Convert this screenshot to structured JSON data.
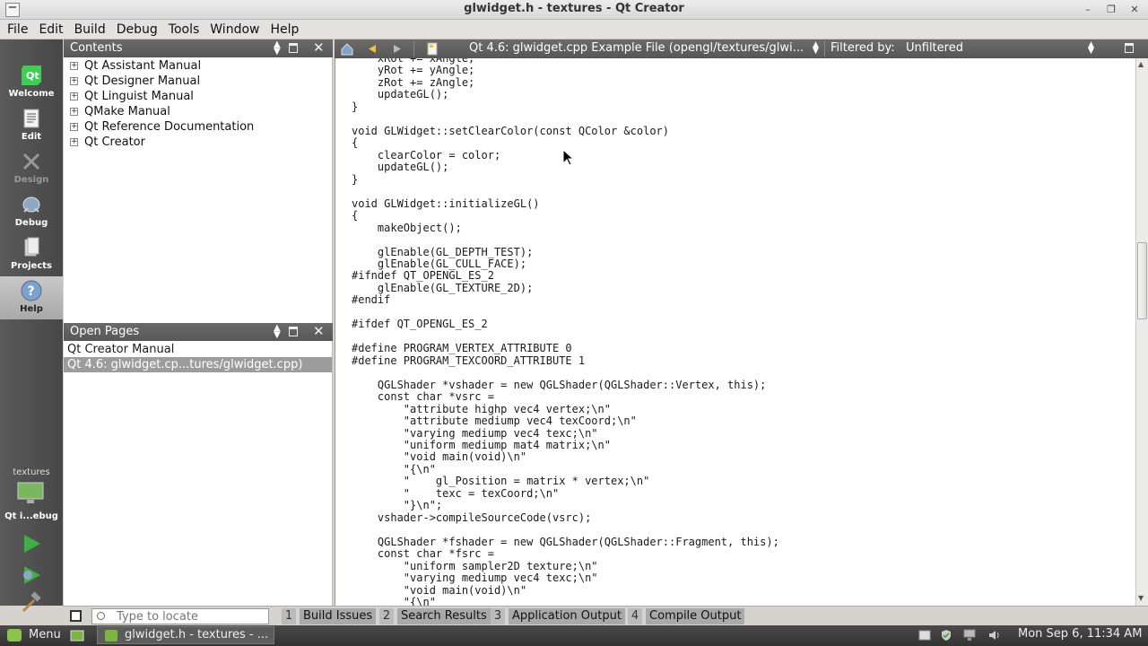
{
  "window": {
    "title": "glwidget.h - textures - Qt Creator"
  },
  "menu": [
    "File",
    "Edit",
    "Build",
    "Debug",
    "Tools",
    "Window",
    "Help"
  ],
  "modes": [
    {
      "label": "Welcome",
      "icon": "qt-logo-icon"
    },
    {
      "label": "Edit",
      "icon": "edit-document-icon"
    },
    {
      "label": "Design",
      "icon": "design-tools-icon"
    },
    {
      "label": "Debug",
      "icon": "debug-bug-icon"
    },
    {
      "label": "Projects",
      "icon": "projects-icon"
    },
    {
      "label": "Help",
      "icon": "help-icon"
    }
  ],
  "target": {
    "project": "textures",
    "config": "Qt i...ebug"
  },
  "contents": {
    "title": "Contents",
    "items": [
      "Qt Assistant Manual",
      "Qt Designer Manual",
      "Qt Linguist Manual",
      "QMake Manual",
      "Qt Reference Documentation",
      "Qt Creator"
    ]
  },
  "open_pages": {
    "title": "Open Pages",
    "items": [
      "Qt Creator Manual",
      "Qt 4.6: glwidget.cp...tures/glwidget.cpp)"
    ],
    "selected": 1
  },
  "editor_toolbar": {
    "doc_title": "Qt 4.6: glwidget.cpp Example File (opengl/textures/glwi...",
    "filter_label": "Filtered by:",
    "filter_value": "Unfiltered"
  },
  "code": "    xRot += xAngle;\n    yRot += yAngle;\n    zRot += zAngle;\n    updateGL();\n}\n\nvoid GLWidget::setClearColor(const QColor &color)\n{\n    clearColor = color;\n    updateGL();\n}\n\nvoid GLWidget::initializeGL()\n{\n    makeObject();\n\n    glEnable(GL_DEPTH_TEST);\n    glEnable(GL_CULL_FACE);\n#ifndef QT_OPENGL_ES_2\n    glEnable(GL_TEXTURE_2D);\n#endif\n\n#ifdef QT_OPENGL_ES_2\n\n#define PROGRAM_VERTEX_ATTRIBUTE 0\n#define PROGRAM_TEXCOORD_ATTRIBUTE 1\n\n    QGLShader *vshader = new QGLShader(QGLShader::Vertex, this);\n    const char *vsrc =\n        \"attribute highp vec4 vertex;\\n\"\n        \"attribute mediump vec4 texCoord;\\n\"\n        \"varying mediump vec4 texc;\\n\"\n        \"uniform mediump mat4 matrix;\\n\"\n        \"void main(void)\\n\"\n        \"{\\n\"\n        \"    gl_Position = matrix * vertex;\\n\"\n        \"    texc = texCoord;\\n\"\n        \"}\\n\";\n    vshader->compileSourceCode(vsrc);\n\n    QGLShader *fshader = new QGLShader(QGLShader::Fragment, this);\n    const char *fsrc =\n        \"uniform sampler2D texture;\\n\"\n        \"varying mediump vec4 texc;\\n\"\n        \"void main(void)\\n\"\n        \"{\\n\"",
  "locator": {
    "placeholder": "Type to locate"
  },
  "output_panes": [
    {
      "num": "1",
      "label": "Build Issues"
    },
    {
      "num": "2",
      "label": "Search Results"
    },
    {
      "num": "3",
      "label": "Application Output"
    },
    {
      "num": "4",
      "label": "Compile Output"
    }
  ],
  "taskbar": {
    "menu_label": "Menu",
    "task_label": "glwidget.h - textures - ...",
    "clock": "Mon Sep  6, 11:34 AM"
  }
}
